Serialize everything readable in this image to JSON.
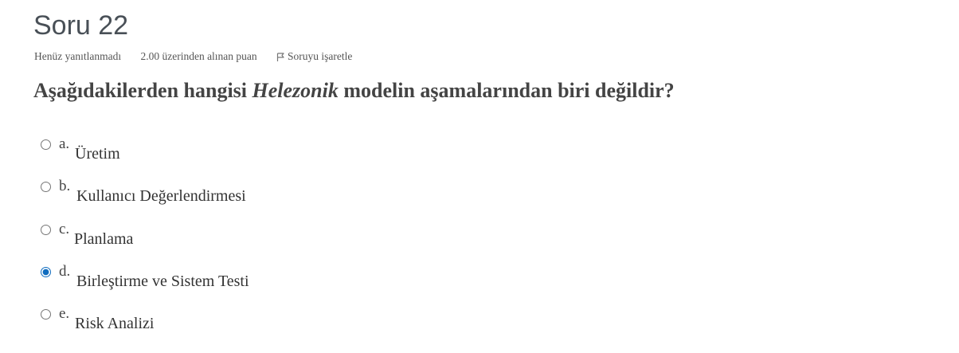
{
  "question": {
    "title": "Soru 22",
    "state": "Henüz yanıtlanmadı",
    "grade": "2.00 üzerinden alınan puan",
    "flag_label": "Soruyu işaretle",
    "text_before": "Aşağıdakilerden hangisi ",
    "text_emphasis": "Helezonik",
    "text_after": " modelin aşamalarından biri değildir?"
  },
  "answers": [
    {
      "letter": "a.",
      "text": "Üretim",
      "selected": false
    },
    {
      "letter": "b.",
      "text": "Kullanıcı Değerlendirmesi",
      "selected": false
    },
    {
      "letter": "c.",
      "text": "Planlama",
      "selected": false
    },
    {
      "letter": "d.",
      "text": "Birleştirme ve Sistem Testi",
      "selected": true
    },
    {
      "letter": "e.",
      "text": "Risk Analizi",
      "selected": false
    }
  ],
  "icons": {
    "flag": "flag-icon"
  },
  "colors": {
    "radio_selected": "#0f6cbf"
  }
}
